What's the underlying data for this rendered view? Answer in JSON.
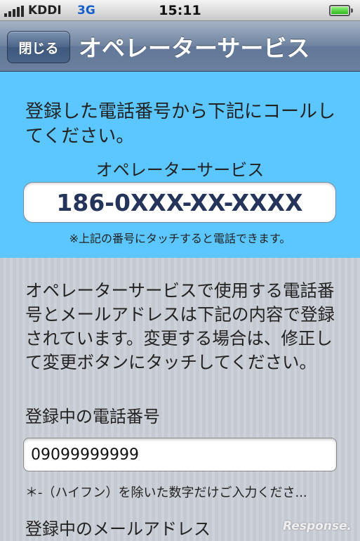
{
  "status_bar": {
    "carrier": "KDDI",
    "network": "3G",
    "time": "15:11"
  },
  "nav": {
    "close_label": "閉じる",
    "title": "オペレーターサービス"
  },
  "call_panel": {
    "intro_text": "登録した電話番号から下記にコールしてください。",
    "service_label": "オペレーターサービス",
    "phone_number": "186-0XXX-XX-XXXX",
    "tap_note": "※上記の番号にタッチすると電話できます。"
  },
  "registration": {
    "info_text": "オペレーターサービスで使用する電話番号とメールアドレスは下記の内容で登録されています。変更する場合は、修正して変更ボタンにタッチしてください。",
    "phone_label": "登録中の電話番号",
    "phone_value": "09099999999",
    "hyphen_note": "＊-（ハイフン）を除いた数字だけご入力くださ...",
    "email_label": "登録中のメールアドレス"
  },
  "colors": {
    "panel_blue": "#5cc6ff",
    "nav_blue": "#6f84a0"
  }
}
